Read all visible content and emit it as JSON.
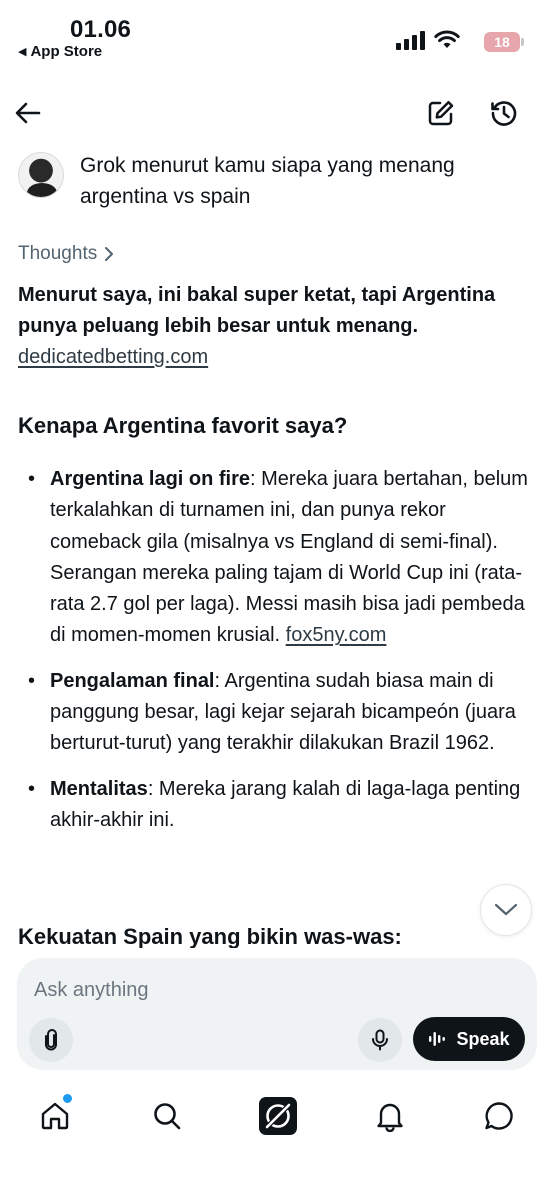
{
  "status_bar": {
    "time": "01.06",
    "back_app": "App Store",
    "battery": "18"
  },
  "top_nav": {
    "back_icon": "arrow-left-icon",
    "new_chat_icon": "compose-icon",
    "history_icon": "history-icon"
  },
  "prompt": {
    "text": "Grok menurut kamu siapa yang menang argentina vs spain"
  },
  "answer": {
    "thoughts_label": "Thoughts",
    "lead_text": "Menurut saya, ini bakal super ketat, tapi Argentina punya peluang lebih besar untuk menang.",
    "lead_source": "dedicatedbetting.com",
    "section1_heading": "Kenapa Argentina favorit saya?",
    "points": [
      {
        "title": "Argentina lagi on fire",
        "body": ": Mereka juara bertahan, belum terkalahkan di turnamen ini, dan punya rekor comeback gila (misalnya vs England di semi-final). Serangan mereka paling tajam di World Cup ini (rata-rata 2.7 gol per laga). Messi masih bisa jadi pembeda di momen-momen krusial.",
        "source": "fox5ny.com"
      },
      {
        "title": "Pengalaman final",
        "body": ": Argentina sudah biasa main di panggung besar, lagi kejar sejarah bicampeón (juara berturut-turut) yang terakhir dilakukan Brazil 1962.",
        "source": ""
      },
      {
        "title": "Mentalitas",
        "body": ": Mereka jarang kalah di laga-laga penting akhir-akhir ini.",
        "source": ""
      }
    ],
    "section2_heading": "Kekuatan Spain yang bikin was-was:"
  },
  "composer": {
    "placeholder": "Ask anything",
    "speak_label": "Speak"
  },
  "bottom_nav": {
    "tabs": [
      "home-icon",
      "search-icon",
      "grok-icon",
      "notifications-icon",
      "messages-icon"
    ]
  },
  "colors": {
    "text": "#0f1419",
    "muted": "#536471",
    "composer_bg": "#eff3f4",
    "accent_dot": "#1d9bf0",
    "battery": "#e6a6ab"
  }
}
